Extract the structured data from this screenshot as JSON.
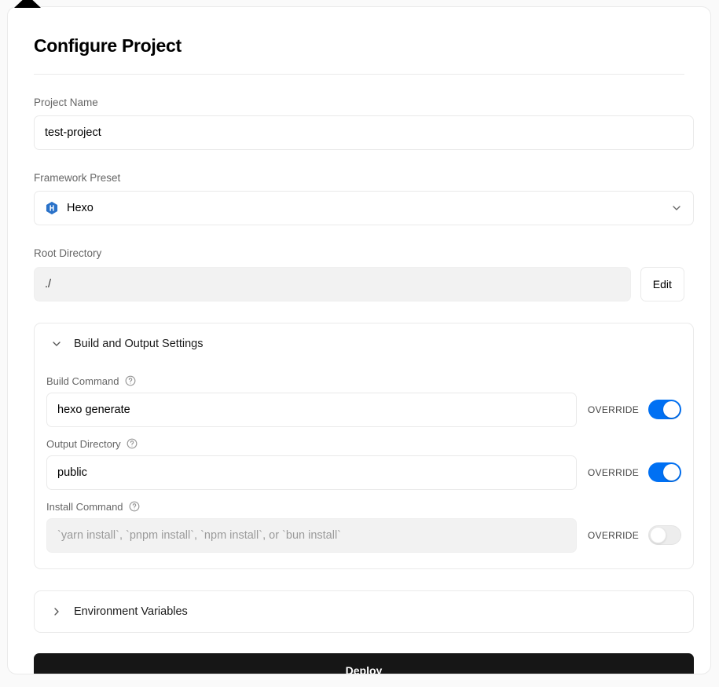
{
  "header": {
    "title": "Configure Project"
  },
  "fields": {
    "project_name": {
      "label": "Project Name",
      "value": "test-project"
    },
    "framework_preset": {
      "label": "Framework Preset",
      "value": "Hexo",
      "icon": "hexo-icon",
      "chevron": "chevron-down-icon"
    },
    "root_directory": {
      "label": "Root Directory",
      "value": "./",
      "edit_label": "Edit"
    }
  },
  "build_panel": {
    "title": "Build and Output Settings",
    "chevron": "chevron-down-icon",
    "rows": [
      {
        "label": "Build Command",
        "help": "help-circle-icon",
        "value": "hexo generate",
        "placeholder": "",
        "override_label": "OVERRIDE",
        "override_on": true,
        "disabled": false
      },
      {
        "label": "Output Directory",
        "help": "help-circle-icon",
        "value": "public",
        "placeholder": "",
        "override_label": "OVERRIDE",
        "override_on": true,
        "disabled": false
      },
      {
        "label": "Install Command",
        "help": "help-circle-icon",
        "value": "",
        "placeholder": "`yarn install`, `pnpm install`, `npm install`, or `bun install`",
        "override_label": "OVERRIDE",
        "override_on": false,
        "disabled": true
      }
    ]
  },
  "env_panel": {
    "title": "Environment Variables",
    "chevron": "chevron-right-icon"
  },
  "deploy": {
    "label": "Deploy"
  },
  "colors": {
    "accent": "#0070f3",
    "deploy_bg": "#161616",
    "hexo_blue": "#2a72c9",
    "border": "#eaeaea",
    "disabled_bg": "#f2f2f2"
  }
}
